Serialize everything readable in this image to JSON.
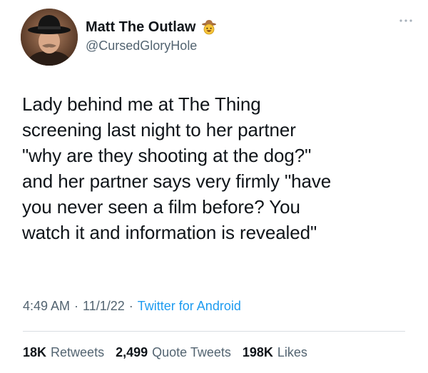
{
  "author": {
    "display_name": "Matt The Outlaw",
    "handle": "@CursedGloryHole",
    "badge_icon": "cowboy-face-icon",
    "avatar_icon": "man-with-black-hat-avatar"
  },
  "menu": {
    "icon": "more-dots-icon"
  },
  "tweet": {
    "text": "Lady behind me at The Thing\nscreening last night to her partner\n\"why are they shooting at the dog?\"\nand her partner says very firmly \"have\nyou never seen a film before? You\nwatch it and information is revealed\""
  },
  "meta": {
    "time": "4:49 AM",
    "separator": "·",
    "date": "11/1/22",
    "source": "Twitter for Android"
  },
  "stats": {
    "retweets_count": "18K",
    "retweets_label": "Retweets",
    "quotes_count": "2,499",
    "quotes_label": "Quote Tweets",
    "likes_count": "198K",
    "likes_label": "Likes"
  },
  "colors": {
    "text_primary": "#0f1419",
    "text_secondary": "#536471",
    "link": "#1d9bf0",
    "divider": "#d9dee2"
  }
}
